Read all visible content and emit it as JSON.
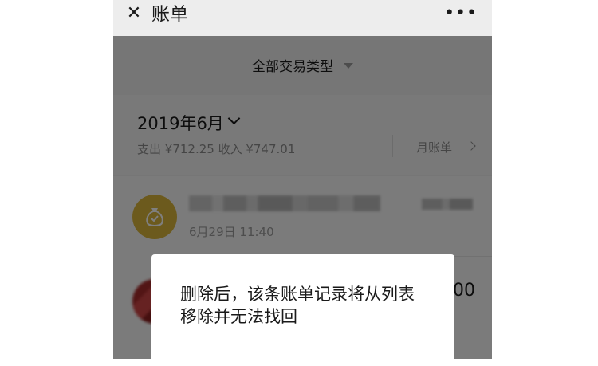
{
  "header": {
    "title": "账单",
    "close_icon": "close-icon",
    "more_icon": "more-icon"
  },
  "filter": {
    "label": "全部交易类型"
  },
  "month": {
    "title": "2019年6月",
    "summary": "支出 ¥712.25 收入 ¥747.01",
    "bill_link": "月账单"
  },
  "transactions": [
    {
      "date": "6月29日 11:40",
      "icon": "moneybag-icon"
    },
    {
      "amount_visible": "00"
    }
  ],
  "dialog": {
    "message": "删除后，该条账单记录将从列表移除并无法找回"
  },
  "colors": {
    "accent_gold": "#d9b43a",
    "overlay": "rgba(0,0,0,0.5)"
  }
}
